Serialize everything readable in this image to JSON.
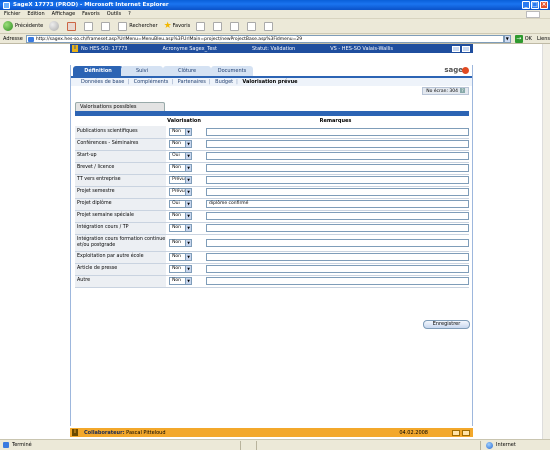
{
  "window": {
    "title": "SageX 17773 (PROD) - Microsoft Internet Explorer"
  },
  "menu": [
    "Fichier",
    "Edition",
    "Affichage",
    "Favoris",
    "Outils",
    "?"
  ],
  "toolbar": {
    "back_label": "Précédente",
    "search_label": "Rechercher",
    "favorites_label": "Favoris"
  },
  "address": {
    "label": "Adresse",
    "url": "http://sagex.hes-so.ch/frameset.asp?UrlMenu=MenuBleu.asp%3FUrlMain=project/newProjectBase.asp%3Fidmenu=29",
    "go_label": "OK",
    "links_label": "Liens"
  },
  "infobar": {
    "project_no": "No HES-SO: 17773",
    "acronym": "Acronyme Sagex_Test",
    "status": "Statut: Validation",
    "vs": "VS - HES-SO Valais-Wallis"
  },
  "tabs": [
    {
      "label": "Définition",
      "active": true
    },
    {
      "label": "Suivi",
      "active": false
    },
    {
      "label": "Clôture",
      "active": false
    },
    {
      "label": "Documents",
      "active": false
    }
  ],
  "logo_text": "sage",
  "subnav": {
    "items": [
      "Données de base",
      "Compléments",
      "Partenaires",
      "Budget"
    ],
    "current": "Valorisation prévue"
  },
  "screen_no": "No écran: 304",
  "section": {
    "title": "Valorisations possibles",
    "col_valorisation": "Valorisation",
    "col_remarques": "Remarques"
  },
  "rows": [
    {
      "label": "Publications scientifiques",
      "value": "Non",
      "remark": ""
    },
    {
      "label": "Conférences - Séminaires",
      "value": "Non",
      "remark": ""
    },
    {
      "label": "Start-up",
      "value": "Oui",
      "remark": ""
    },
    {
      "label": "Brevet / licence",
      "value": "Non",
      "remark": ""
    },
    {
      "label": "TT vers entreprise",
      "value": "Prévu",
      "remark": ""
    },
    {
      "label": "Projet semestre",
      "value": "Prévu",
      "remark": ""
    },
    {
      "label": "Projet diplôme",
      "value": "Oui",
      "remark": "diplôme confirmé"
    },
    {
      "label": "Projet semaine spéciale",
      "value": "Non",
      "remark": ""
    },
    {
      "label": "Intégration cours / TP",
      "value": "Non",
      "remark": ""
    },
    {
      "label": "Intégration cours formation continue et/ou postgrade",
      "value": "Non",
      "remark": ""
    },
    {
      "label": "Exploitation par autre école",
      "value": "Non",
      "remark": ""
    },
    {
      "label": "Article de presse",
      "value": "Non",
      "remark": ""
    },
    {
      "label": "Autre",
      "value": "Non",
      "remark": ""
    }
  ],
  "save_label": "Enregistrer",
  "footer": {
    "collab_label": "Collaborateur:",
    "collab_name": "Pascal Pitteloud",
    "date": "04.02.2008"
  },
  "status": {
    "left": "Terminé",
    "zone": "Internet"
  }
}
